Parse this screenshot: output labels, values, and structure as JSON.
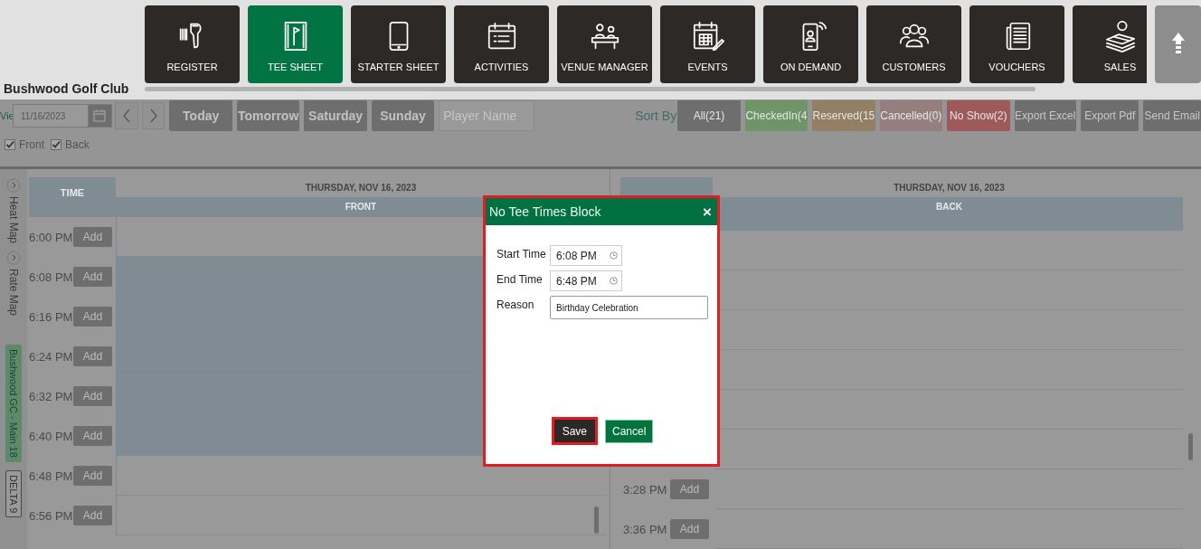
{
  "header": {
    "club_name": "Bushwood Golf Club",
    "nav": [
      {
        "label": "REGISTER",
        "selected": false
      },
      {
        "label": "TEE SHEET",
        "selected": true
      },
      {
        "label": "STARTER SHEET",
        "selected": false
      },
      {
        "label": "ACTIVITIES",
        "selected": false
      },
      {
        "label": "VENUE MANAGER",
        "selected": false
      },
      {
        "label": "EVENTS",
        "selected": false
      },
      {
        "label": "ON DEMAND",
        "selected": false
      },
      {
        "label": "CUSTOMERS",
        "selected": false
      },
      {
        "label": "VOUCHERS",
        "selected": false
      },
      {
        "label": "SALES",
        "selected": false
      }
    ]
  },
  "toolbar": {
    "view_label": "Vie",
    "date": "11/16/2023",
    "quick_dates": [
      "Today",
      "Tomorrow",
      "Saturday",
      "Sunday"
    ],
    "player_search": {
      "placeholder": "Player Name"
    },
    "sort_label": "Sort By",
    "filters": [
      {
        "label": "All(21)",
        "color": "#6e6e6e"
      },
      {
        "label": "CheckedIn(4",
        "color": "#6f9468"
      },
      {
        "label": "Reserved(15",
        "color": "#937f64"
      },
      {
        "label": "Cancelled(0)",
        "color": "#957e7e"
      },
      {
        "label": "No Show(2)",
        "color": "#9e5a5a"
      }
    ],
    "actions": [
      "Export Excel",
      "Export Pdf",
      "Send Email"
    ],
    "nines": [
      {
        "label": "Front",
        "checked": true
      },
      {
        "label": "Back",
        "checked": true
      }
    ]
  },
  "side_tabs": [
    {
      "kind": "map",
      "label": "Heat Map"
    },
    {
      "kind": "map",
      "label": "Rate Map"
    },
    {
      "kind": "course",
      "label": "Bushwood GC - Main 18",
      "selected": true
    },
    {
      "kind": "course",
      "label": "DELTA 9",
      "selected": false
    }
  ],
  "front": {
    "date": "THURSDAY, NOV 16, 2023",
    "time_header": "TIME",
    "column": "FRONT",
    "slots": [
      {
        "time": "6:00 PM",
        "button": "Add",
        "blocked": false
      },
      {
        "time": "6:08 PM",
        "button": "Add",
        "blocked": true
      },
      {
        "time": "6:16 PM",
        "button": "Add",
        "blocked": true
      },
      {
        "time": "6:24 PM",
        "button": "Add",
        "blocked": true
      },
      {
        "time": "6:32 PM",
        "button": "Add",
        "blocked": true
      },
      {
        "time": "6:40 PM",
        "button": "Add",
        "blocked": true
      },
      {
        "time": "6:48 PM",
        "button": "Add",
        "blocked": false
      },
      {
        "time": "6:56 PM",
        "button": "Add",
        "blocked": false
      }
    ]
  },
  "back": {
    "date": "THURSDAY, NOV 16, 2023",
    "column": "BACK",
    "slots": [
      {
        "time": "3:28 PM",
        "button": "Add"
      },
      {
        "time": "3:36 PM",
        "button": "Add"
      }
    ]
  },
  "dialog": {
    "title": "No Tee Times Block",
    "close": "×",
    "highlighted": true,
    "fields": [
      {
        "kind": "time",
        "label": "Start Time",
        "value": "6:08 PM"
      },
      {
        "kind": "time",
        "label": "End Time",
        "value": "6:48 PM"
      },
      {
        "kind": "text",
        "label": "Reason",
        "value": "Birthday Celebration"
      }
    ],
    "buttons": [
      {
        "kind": "primary",
        "label": "Save",
        "highlighted": true
      },
      {
        "kind": "secondary",
        "label": "Cancel",
        "highlighted": false
      }
    ]
  }
}
